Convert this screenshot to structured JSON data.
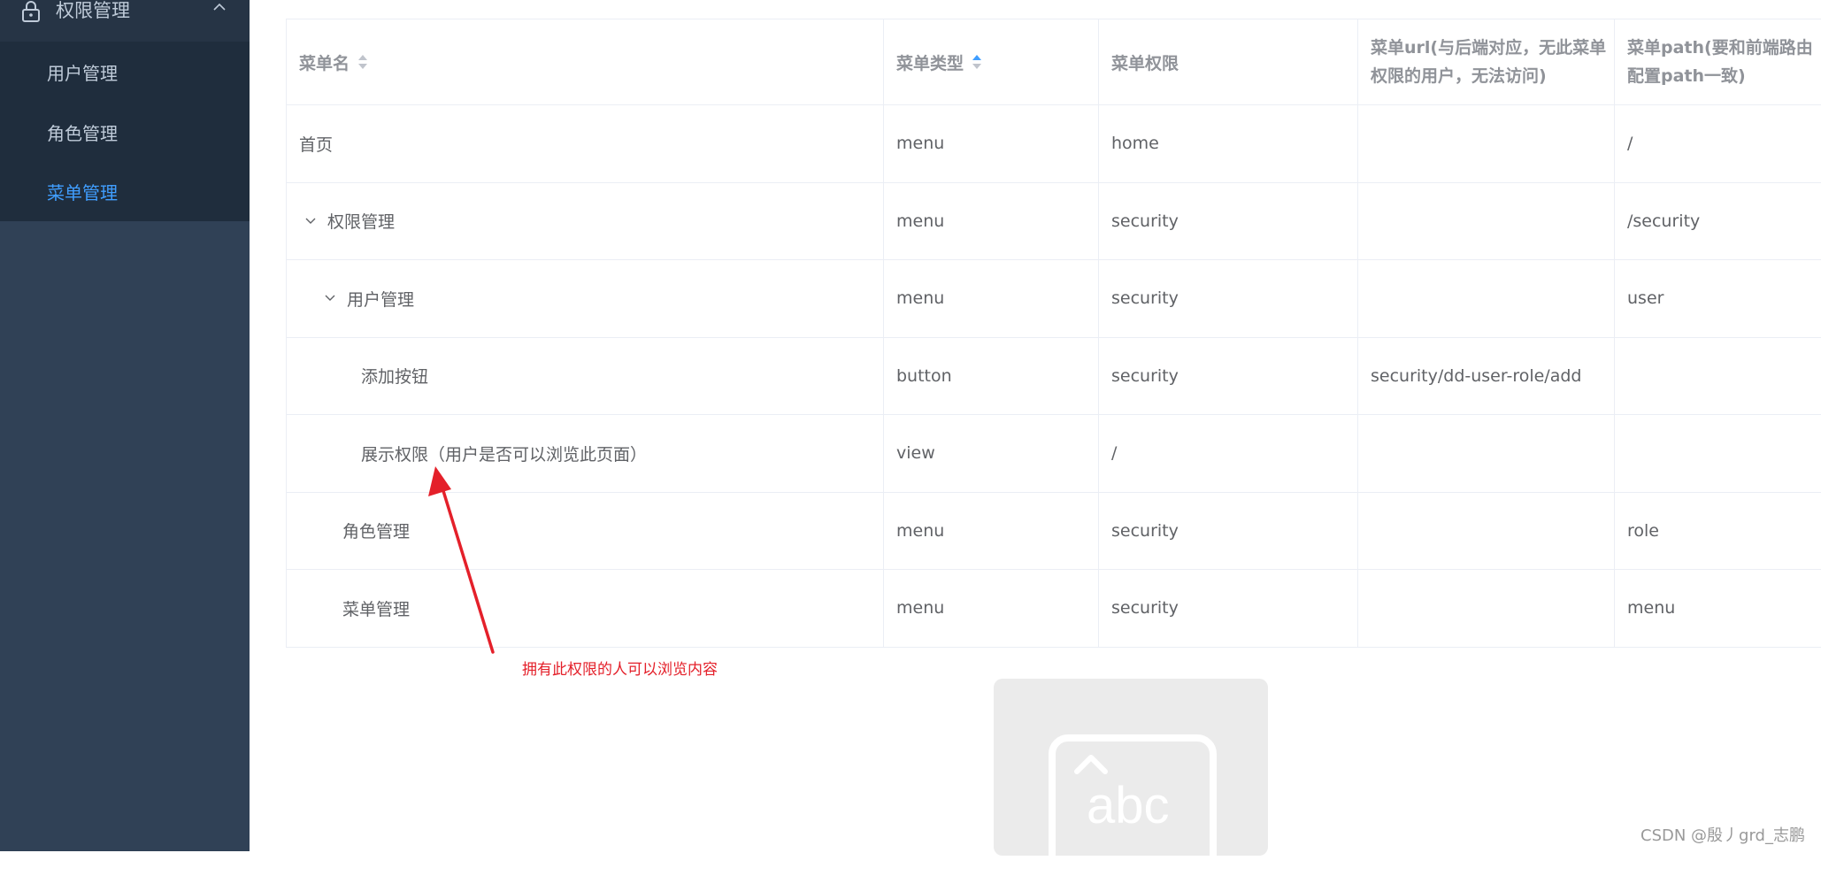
{
  "sidebar": {
    "submenu_title": "权限管理",
    "items": [
      {
        "label": "用户管理",
        "active": false
      },
      {
        "label": "角色管理",
        "active": false
      },
      {
        "label": "菜单管理",
        "active": true
      }
    ]
  },
  "table": {
    "headers": {
      "name": "菜单名",
      "type": "菜单类型",
      "perm": "菜单权限",
      "url": "菜单url(与后端对应，无此菜单权限的用户，无法访问)",
      "path": "菜单path(要和前端路由配置path一致)"
    },
    "rows": [
      {
        "name": "首页",
        "type": "menu",
        "perm": "home",
        "url": "",
        "path": "/"
      },
      {
        "name": "权限管理",
        "type": "menu",
        "perm": "security",
        "url": "",
        "path": "/security"
      },
      {
        "name": "用户管理",
        "type": "menu",
        "perm": "security",
        "url": "",
        "path": "user"
      },
      {
        "name": "添加按钮",
        "type": "button",
        "perm": "security",
        "url": "security/dd-user-role/add",
        "path": ""
      },
      {
        "name": "展示权限（用户是否可以浏览此页面）",
        "type": "view",
        "perm": "/",
        "url": "",
        "path": ""
      },
      {
        "name": "角色管理",
        "type": "menu",
        "perm": "security",
        "url": "",
        "path": "role"
      },
      {
        "name": "菜单管理",
        "type": "menu",
        "perm": "security",
        "url": "",
        "path": "menu"
      }
    ]
  },
  "annotation": {
    "text": "拥有此权限的人可以浏览内容",
    "color": "#e4202a"
  },
  "placeholder_image": {
    "text": "abc"
  },
  "watermark": "CSDN @殷丿grd_志鹏",
  "colors": {
    "sidebar_bg": "#304156",
    "submenu_bg": "#1f2d3d",
    "active": "#409eff",
    "sort_active": "#409eff"
  }
}
